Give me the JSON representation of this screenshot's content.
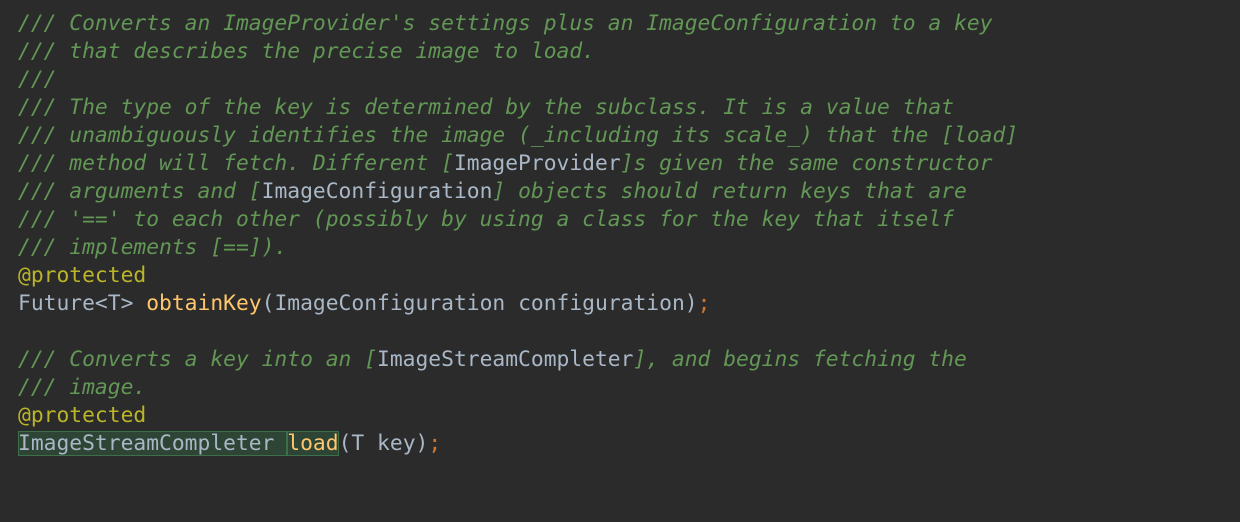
{
  "code": {
    "lines": [
      {
        "type": "comment",
        "segments": [
          {
            "t": "plain",
            "v": "/// Converts an ImageProvider's settings plus an ImageConfiguration to a key"
          }
        ]
      },
      {
        "type": "comment",
        "segments": [
          {
            "t": "plain",
            "v": "/// that describes the precise image to load."
          }
        ]
      },
      {
        "type": "comment",
        "segments": [
          {
            "t": "plain",
            "v": "///"
          }
        ]
      },
      {
        "type": "comment",
        "segments": [
          {
            "t": "plain",
            "v": "/// The type of the key is determined by the subclass. It is a value that"
          }
        ]
      },
      {
        "type": "comment",
        "segments": [
          {
            "t": "plain",
            "v": "/// unambiguously identifies the image (_including its scale_) that the [load]"
          }
        ]
      },
      {
        "type": "comment",
        "segments": [
          {
            "t": "plain",
            "v": "/// method will fetch. Different ["
          },
          {
            "t": "refname",
            "v": "ImageProvider"
          },
          {
            "t": "plain",
            "v": "]s given the same constructor"
          }
        ]
      },
      {
        "type": "comment",
        "segments": [
          {
            "t": "plain",
            "v": "/// arguments and ["
          },
          {
            "t": "refname",
            "v": "ImageConfiguration"
          },
          {
            "t": "plain",
            "v": "] objects should return keys that are"
          }
        ]
      },
      {
        "type": "comment",
        "segments": [
          {
            "t": "plain",
            "v": "/// '==' to each other (possibly by using a class for the key that itself"
          }
        ]
      },
      {
        "type": "comment",
        "segments": [
          {
            "t": "plain",
            "v": "/// implements [==])."
          }
        ]
      },
      {
        "type": "code",
        "segments": [
          {
            "t": "annotation-at",
            "v": "@"
          },
          {
            "t": "annotation",
            "v": "protected"
          }
        ]
      },
      {
        "type": "code",
        "segments": [
          {
            "t": "type",
            "v": "Future<T> "
          },
          {
            "t": "method",
            "v": "obtainKey"
          },
          {
            "t": "punct",
            "v": "("
          },
          {
            "t": "type",
            "v": "ImageConfiguration "
          },
          {
            "t": "param",
            "v": "configuration"
          },
          {
            "t": "punct",
            "v": ")"
          },
          {
            "t": "semi",
            "v": ";"
          }
        ]
      },
      {
        "type": "blank",
        "segments": []
      },
      {
        "type": "comment",
        "segments": [
          {
            "t": "plain",
            "v": "/// Converts a key into an ["
          },
          {
            "t": "refname",
            "v": "ImageStreamCompleter"
          },
          {
            "t": "plain",
            "v": "], and begins fetching the"
          }
        ]
      },
      {
        "type": "comment",
        "segments": [
          {
            "t": "plain",
            "v": "/// image."
          }
        ]
      },
      {
        "type": "code",
        "segments": [
          {
            "t": "annotation-at",
            "v": "@"
          },
          {
            "t": "annotation",
            "v": "protected"
          }
        ]
      },
      {
        "type": "code",
        "segments": [
          {
            "t": "sel-type",
            "v": "ImageStreamCompleter "
          },
          {
            "t": "sel-method",
            "v": "load"
          },
          {
            "t": "punct",
            "v": "("
          },
          {
            "t": "type",
            "v": "T "
          },
          {
            "t": "param",
            "v": "key"
          },
          {
            "t": "punct",
            "v": ")"
          },
          {
            "t": "semi",
            "v": ";"
          }
        ]
      }
    ]
  }
}
